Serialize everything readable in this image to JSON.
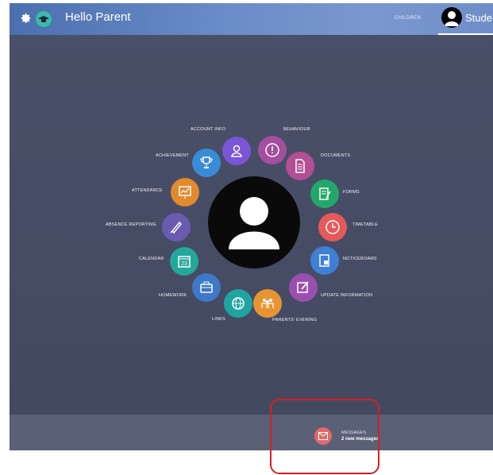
{
  "header": {
    "title": "Hello Parent",
    "children_link": "CHILDREN",
    "student_tab": "Stude"
  },
  "menu": {
    "items": [
      {
        "key": "account-info",
        "label": "ACCOUNT INFO",
        "color": "#7a55d6",
        "icon": "user-icon"
      },
      {
        "key": "behaviour",
        "label": "BEHAVIOUR",
        "color": "#a34f9e",
        "icon": "alert-icon"
      },
      {
        "key": "documents",
        "label": "DOCUMENTS",
        "color": "#b24f95",
        "icon": "document-icon"
      },
      {
        "key": "forms",
        "label": "FORMS",
        "color": "#22a86a",
        "icon": "form-icon"
      },
      {
        "key": "timetable",
        "label": "TIMETABLE",
        "color": "#e45a5a",
        "icon": "clock-icon"
      },
      {
        "key": "noticeboard",
        "label": "NOTICEBOARD",
        "color": "#3f7fd6",
        "icon": "noticeboard-icon"
      },
      {
        "key": "update-information",
        "label": "UPDATE INFORMATION",
        "color": "#9a4fb0",
        "icon": "edit-icon"
      },
      {
        "key": "parents-evening",
        "label": "PARENTS' EVENING",
        "color": "#e79532",
        "icon": "people-icon"
      },
      {
        "key": "links",
        "label": "LINKS",
        "color": "#1fa5a0",
        "icon": "globe-icon"
      },
      {
        "key": "homework",
        "label": "HOMEWORK",
        "color": "#3e78c8",
        "icon": "briefcase-icon"
      },
      {
        "key": "calendar",
        "label": "CALENDAR",
        "color": "#25a79a",
        "icon": "calendar-icon",
        "icon_text": "23"
      },
      {
        "key": "absence-reporting",
        "label": "ABSENCE REPORTING",
        "color": "#6a5bb0",
        "icon": "rocket-icon"
      },
      {
        "key": "attendance",
        "label": "ATTENDANCE",
        "color": "#e38a2e",
        "icon": "chart-icon"
      },
      {
        "key": "achievement",
        "label": "ACHIEVEMENT",
        "color": "#3a8bd6",
        "icon": "trophy-icon"
      }
    ]
  },
  "messages": {
    "title": "MESSAGES",
    "count_text": "2 new messages"
  }
}
